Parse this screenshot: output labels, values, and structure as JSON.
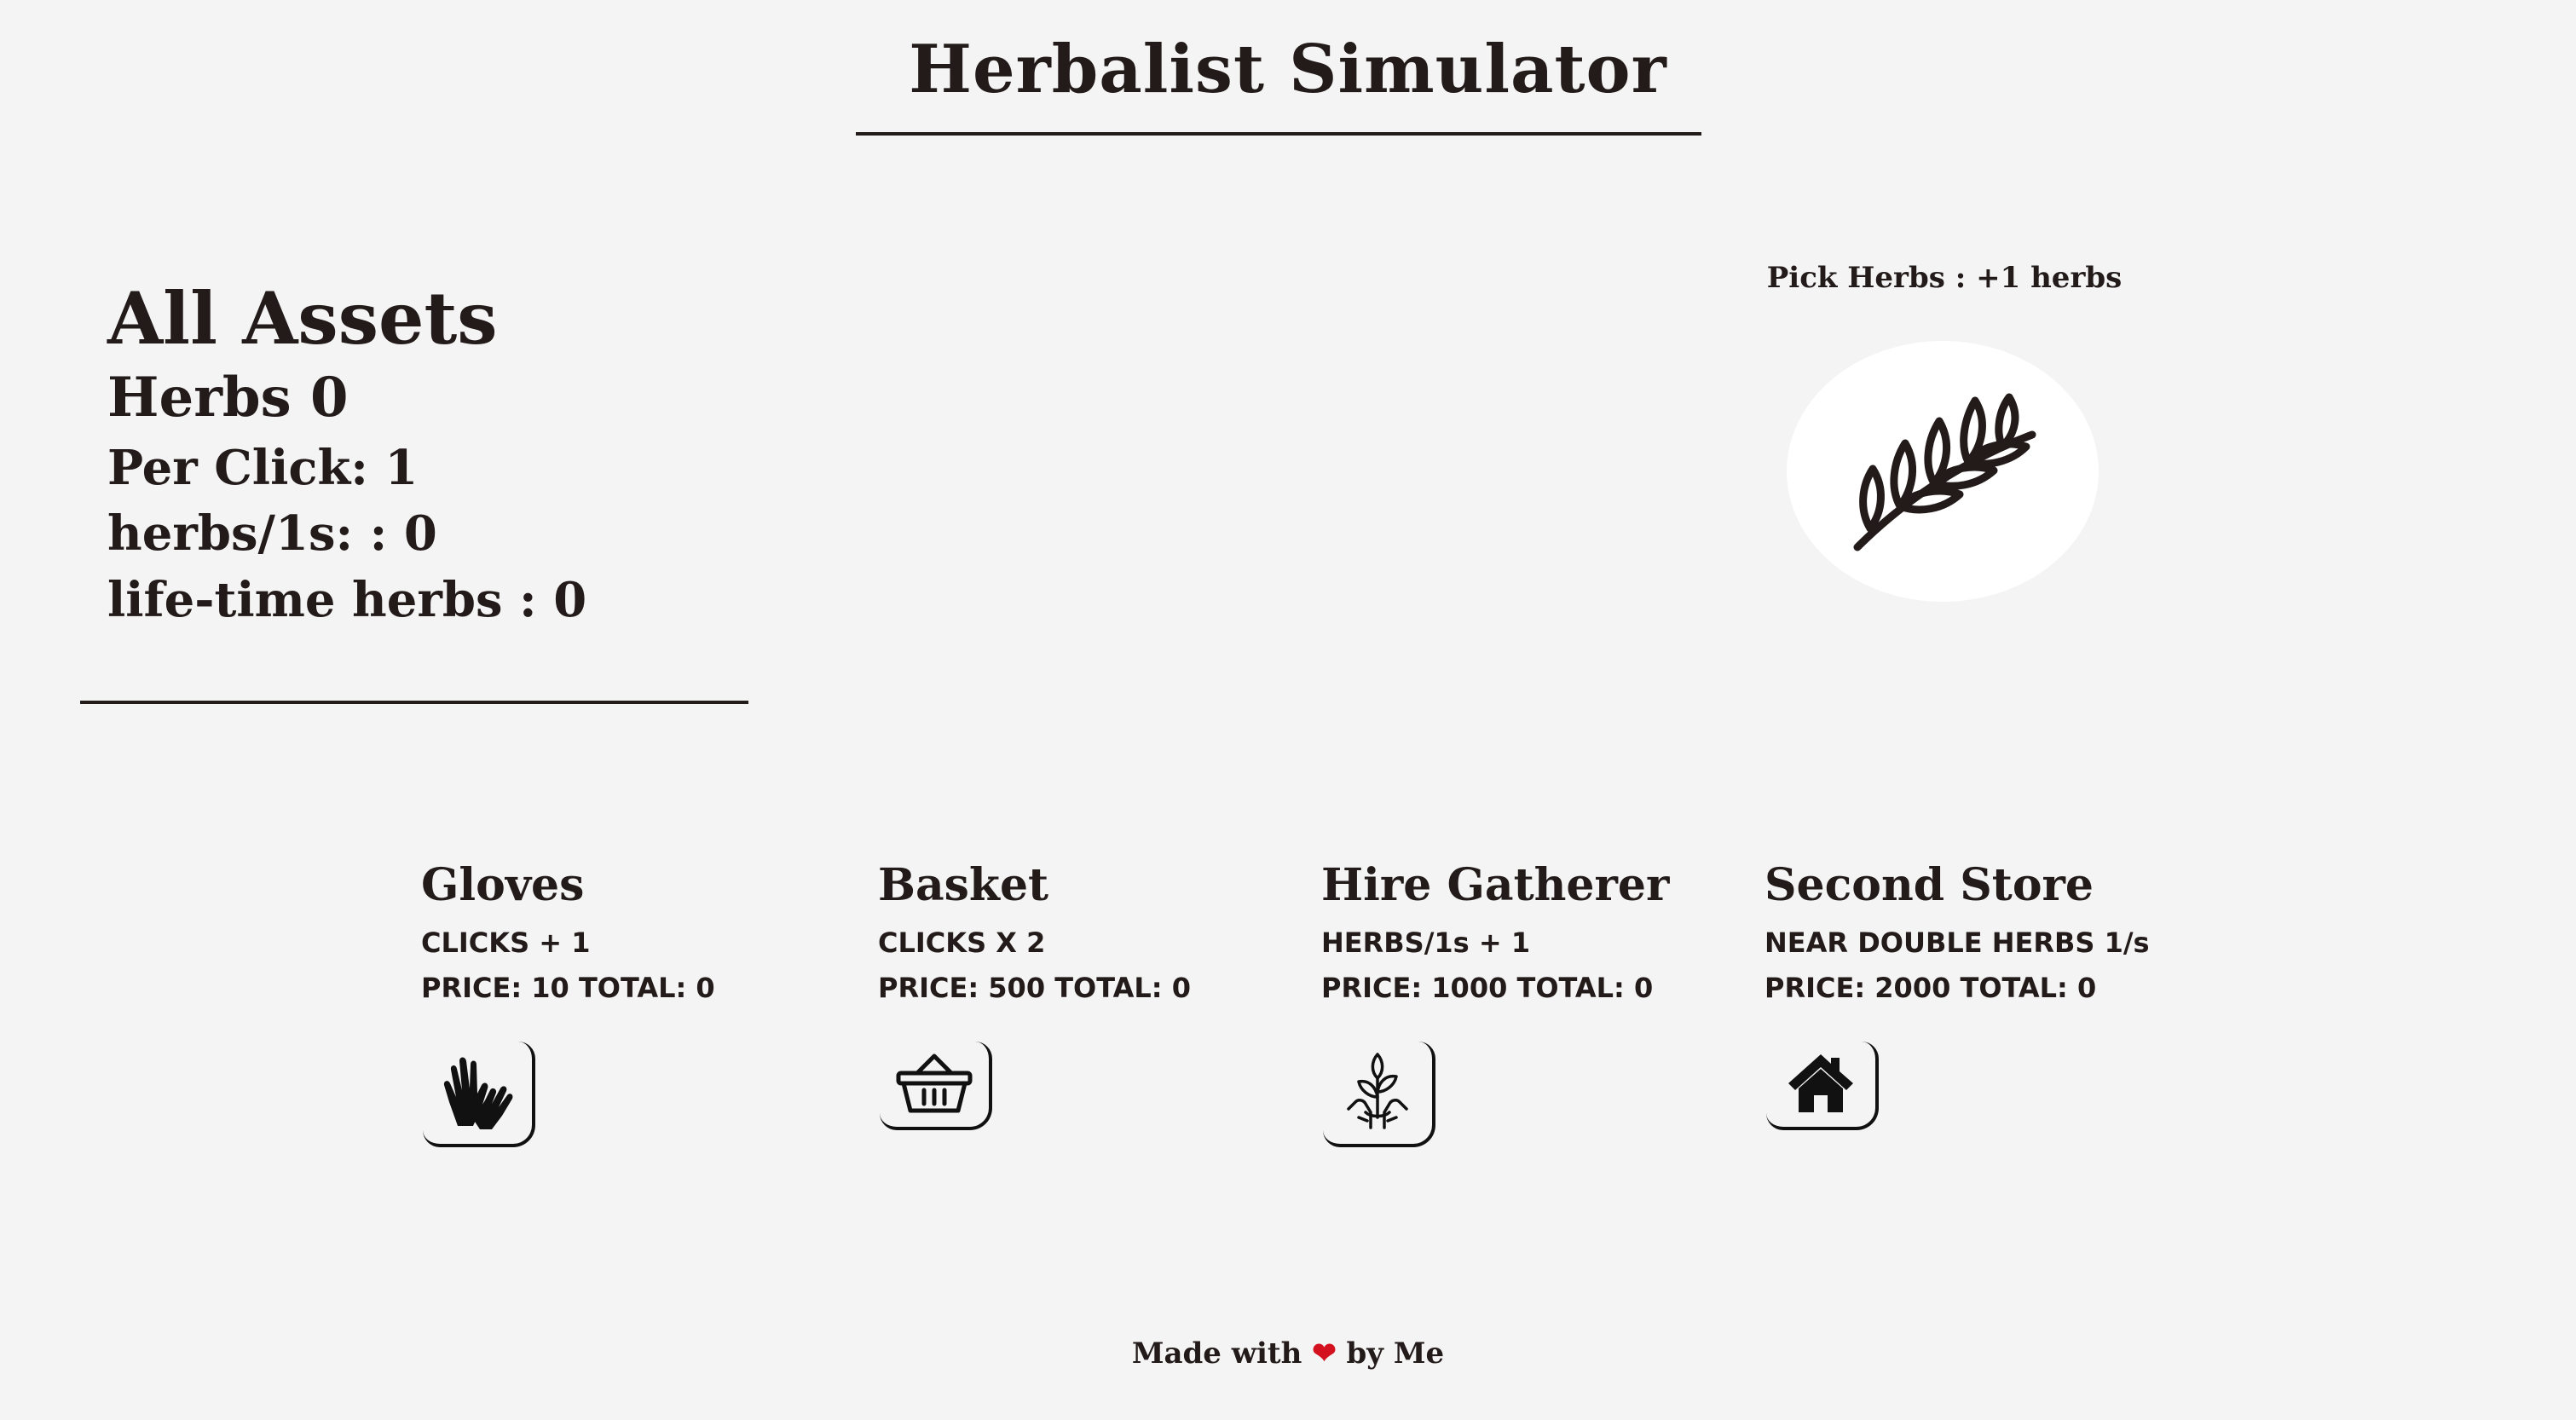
{
  "header": {
    "title": "Herbalist Simulator"
  },
  "assets": {
    "heading": "All Assets",
    "herbs": "Herbs 0",
    "per_click": "Per Click: 1",
    "herbs_per_second": "herbs/1s: : 0",
    "lifetime_herbs": "life-time herbs : 0"
  },
  "pick": {
    "label": "Pick Herbs : +1 herbs",
    "icon": "herb-branch-icon"
  },
  "shop": [
    {
      "name": "Gloves",
      "effect": "CLICKS + 1",
      "price_line": "PRICE: 10 TOTAL: 0",
      "icon": "gloves-icon"
    },
    {
      "name": "Basket",
      "effect": "CLICKS X 2",
      "price_line": "PRICE: 500 TOTAL: 0",
      "icon": "basket-icon"
    },
    {
      "name": "Hire Gatherer",
      "effect": "HERBS/1s + 1",
      "price_line": "PRICE: 1000 TOTAL: 0",
      "icon": "plant-in-hands-icon"
    },
    {
      "name": "Second Store",
      "effect": "NEAR DOUBLE HERBS 1/s",
      "price_line": "PRICE: 2000 TOTAL: 0",
      "icon": "house-icon"
    }
  ],
  "footer": {
    "prefix": "Made with",
    "heart": "❤",
    "suffix": "by Me"
  },
  "colors": {
    "background": "#f4f4f4",
    "text": "#231a1a",
    "heart": "#d3111f"
  }
}
